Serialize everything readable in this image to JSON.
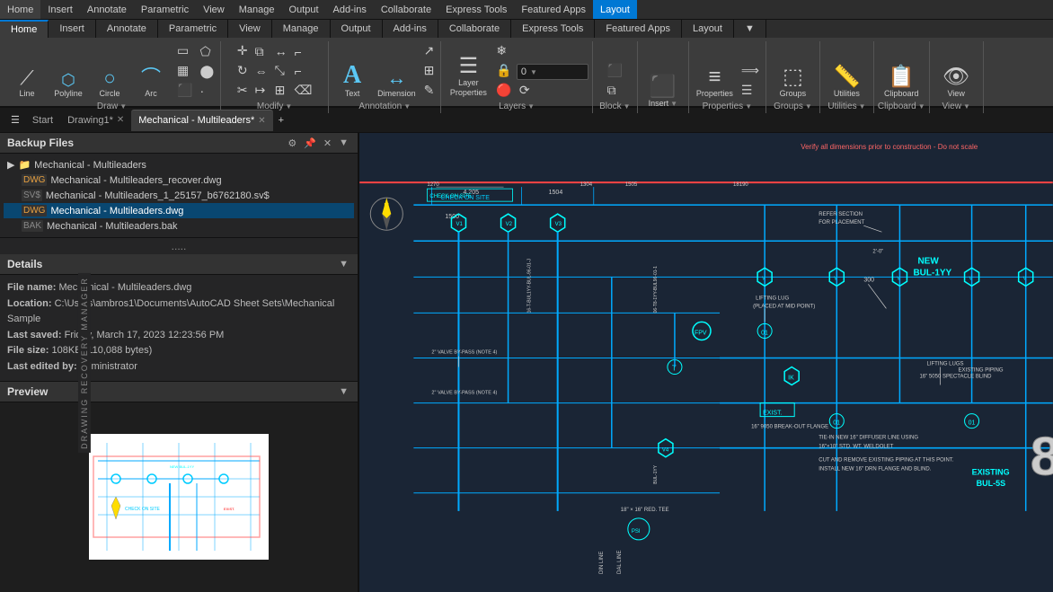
{
  "menubar": {
    "items": [
      "Home",
      "Insert",
      "Annotate",
      "Parametric",
      "View",
      "Manage",
      "Output",
      "Add-ins",
      "Collaborate",
      "Express Tools",
      "Featured Apps",
      "Layout"
    ]
  },
  "ribbon": {
    "groups": [
      {
        "label": "Draw",
        "buttons_large": [
          {
            "id": "line",
            "label": "Line",
            "icon": "⟋"
          },
          {
            "id": "polyline",
            "label": "Polyline",
            "icon": "⬡"
          },
          {
            "id": "circle",
            "label": "Circle",
            "icon": "○"
          },
          {
            "id": "arc",
            "label": "Arc",
            "icon": "⌒"
          }
        ]
      },
      {
        "label": "Modify"
      },
      {
        "label": "Annotation",
        "buttons_large": [
          {
            "id": "text",
            "label": "Text",
            "icon": "A"
          },
          {
            "id": "dimension",
            "label": "Dimension",
            "icon": "↔"
          }
        ]
      },
      {
        "label": "Layers",
        "buttons_large": [
          {
            "id": "layer-properties",
            "label": "Layer\nProperties",
            "icon": "☰"
          }
        ]
      },
      {
        "label": "Block"
      },
      {
        "label": "Insert",
        "buttons_large": [
          {
            "id": "insert",
            "label": "Insert",
            "icon": "⬛"
          }
        ]
      },
      {
        "label": "Properties",
        "buttons_large": [
          {
            "id": "properties",
            "label": "Properties",
            "icon": "≡"
          }
        ]
      },
      {
        "label": "Groups",
        "buttons_large": [
          {
            "id": "groups",
            "label": "Groups",
            "icon": "⬚"
          }
        ]
      },
      {
        "label": "Utilities",
        "buttons_large": [
          {
            "id": "utilities",
            "label": "Utilities",
            "icon": "📏"
          }
        ]
      },
      {
        "label": "Clipboard",
        "buttons_large": [
          {
            "id": "clipboard",
            "label": "Clipboard",
            "icon": "📋"
          }
        ]
      },
      {
        "label": "View",
        "buttons_large": [
          {
            "id": "view",
            "label": "View",
            "icon": "👁"
          }
        ]
      }
    ]
  },
  "tabs": {
    "items": [
      {
        "label": "Start",
        "closeable": false,
        "active": false
      },
      {
        "label": "Drawing1*",
        "closeable": true,
        "active": false
      },
      {
        "label": "Mechanical - Multileaders*",
        "closeable": true,
        "active": true
      }
    ],
    "add_tab": "+"
  },
  "left_panel": {
    "title": "Backup Files",
    "collapse_btn": "▲",
    "expand_btn": "▼",
    "close_btn": "✕",
    "pin_btn": "📌",
    "files": {
      "root_label": "Mechanical - Multileaders",
      "items": [
        {
          "name": "Mechanical - Multileaders_recover.dwg",
          "type": "dwg",
          "selected": false
        },
        {
          "name": "Mechanical - Multileaders_1_25157_b6762180.sv$",
          "type": "sv$",
          "selected": false
        },
        {
          "name": "Mechanical - Multileaders.dwg",
          "type": "dwg",
          "selected": true
        },
        {
          "name": "Mechanical - Multileaders.bak",
          "type": "bak",
          "selected": false
        }
      ]
    },
    "dots": ".....",
    "details": {
      "title": "Details",
      "file_name_label": "File name:",
      "file_name_value": "Mechanical - Multileaders.dwg",
      "location_label": "Location:",
      "location_value": "C:\\Users\\ambros1\\Documents\\AutoCAD Sheet Sets\\Mechanical Sample",
      "last_saved_label": "Last saved:",
      "last_saved_value": "Friday, March 17, 2023  12:23:56 PM",
      "file_size_label": "File size:",
      "file_size_value": "108KB (110,088 bytes)",
      "last_edited_label": "Last edited by:",
      "last_edited_value": "Administrator"
    },
    "preview": {
      "title": "Preview"
    },
    "drm_label": "DRAWING RECOVERY MANAGER"
  },
  "drawing": {
    "warning_text": "Verify all dimensions prior to construction - Do not scale",
    "annotation1": "CHECK ON SITE",
    "annotation2": "REFER SECTION FOR PLACEMENT",
    "annotation3": "LIFTING LUG (PLACED AT MID POINT)",
    "annotation4": "LIFTING LUGS",
    "annotation5": "16\" 5050 SPECTACLE BLIND",
    "annotation6": "NEW BUL-1YY",
    "annotation7": "EXISTING BUL-5S",
    "annotation8": "2\" VALVE BY-PASS (NOTE 4)",
    "annotation9": "2\" VALVE BY-PASS (NOTE 4)",
    "annotation10": "TIE-IN NEW 16\" DIFFUSER LINE USING 16\"×10\" STD. WT. WELDOLET",
    "annotation11": "CUT AND REMOVE EXISTING PIPING AT THIS POINT. INSTALL NEW 16\" DRN FLANGE AND BLIND.",
    "annotation12": "EXISTING PIPING",
    "annotation13": "16\" 9050 BREAK-OUT FLANGE"
  }
}
